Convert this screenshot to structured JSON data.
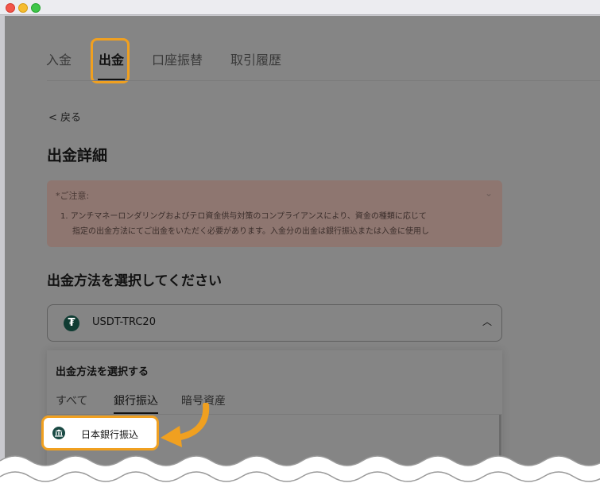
{
  "tabs": [
    {
      "label": "入金"
    },
    {
      "label": "出金"
    },
    {
      "label": "口座振替"
    },
    {
      "label": "取引履歴"
    }
  ],
  "back_label": "< 戻る",
  "page_title": "出金詳細",
  "notice": {
    "heading": "*ご注意:",
    "line1": "1. アンチマネーロンダリングおよびテロ資金供与対策のコンプライアンスにより、資金の種類に応じて",
    "line2": "指定の出金方法にてご出金をいただく必要があります。入金分の出金は銀行振込または入金に使用し"
  },
  "method_section_title": "出金方法を選択してください",
  "method_select": {
    "value": "USDT-TRC20",
    "icon": "tether-icon",
    "icon_glyph": "₮"
  },
  "dropdown": {
    "title": "出金方法を選択する",
    "tabs": [
      {
        "label": "すべて"
      },
      {
        "label": "銀行振込"
      },
      {
        "label": "暗号資産"
      }
    ],
    "items": [
      {
        "label": "日本銀行振込",
        "icon": "bank-icon"
      }
    ]
  },
  "colors": {
    "highlight": "#f0a020",
    "overlay": "#858585"
  }
}
